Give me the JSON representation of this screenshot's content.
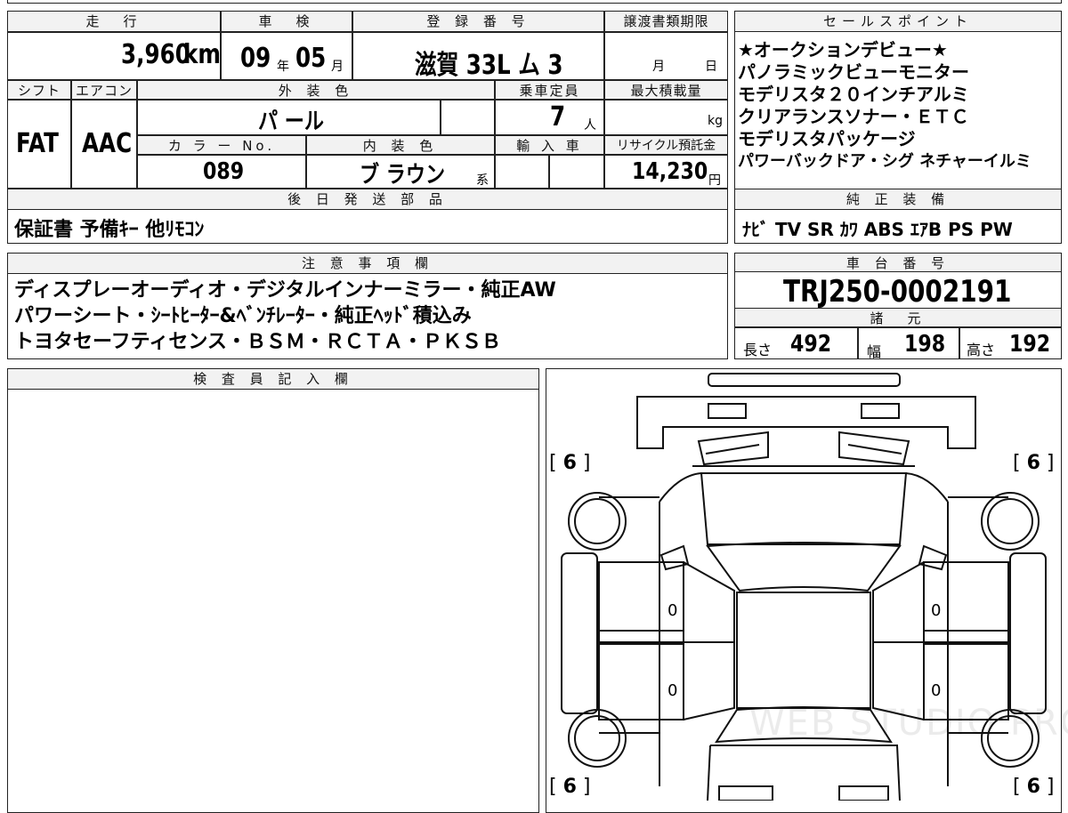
{
  "top": {
    "mileage_label": "走　行",
    "mileage": "3,960",
    "mileage_unit": "km",
    "inspection_label": "車　検",
    "inspection_year": "09",
    "inspection_year_unit": "年",
    "inspection_month": "05",
    "inspection_month_unit": "月",
    "registration_label": "登 録 番 号",
    "registration": "滋賀 33L ム 3",
    "transfer_label": "譲渡書類期限",
    "transfer_month_unit": "月",
    "transfer_day_unit": "日"
  },
  "spec": {
    "shift_label": "シフト",
    "shift": "FAT",
    "ac_label": "エアコン",
    "ac": "AAC",
    "exterior_label": "外 装 色",
    "exterior": "パ ール",
    "capacity_label": "乗車定員",
    "capacity": "7",
    "capacity_unit": "人",
    "max_load_label": "最大積載量",
    "max_load_unit": "kg",
    "color_no_label": "カ ラ ー No.",
    "color_no": "089",
    "interior_label": "内 装 色",
    "interior": "ブ ラウン",
    "interior_suffix": "系",
    "import_label": "輸 入 車",
    "recycle_label": "リサイクル預託金",
    "recycle": "14,230",
    "recycle_unit": "円"
  },
  "parts": {
    "label": "後 日 発 送 部 品",
    "value": "保証書 予備ｷｰ 他ﾘﾓｺﾝ"
  },
  "sales": {
    "label": "セールスポイント",
    "lines": [
      "★オークションデビュー★",
      "パノラミックビューモニター",
      "モデリスタ２０インチアルミ",
      "クリアランスソナー・ＥＴＣ",
      "モデリスタパッケージ",
      "パワーバックドア・シグ ネチャーイルミ"
    ]
  },
  "equipment": {
    "label": "純 正 装 備",
    "value": "ﾅﾋﾞ TV SR ｶﾜ ABS ｴｱB PS PW"
  },
  "notes": {
    "label": "注 意 事 項 欄",
    "lines": [
      "ディスプレーオーディオ・デジタルインナーミラー・純正AW",
      "パワーシート・ｼｰﾄﾋｰﾀｰ&ﾍﾞﾝﾁﾚｰﾀｰ・純正ﾍｯﾄﾞ積込み",
      "トヨタセーフティセンス・ＢＳＭ・ＲＣＴＡ・ＰＫＳＢ"
    ]
  },
  "chassis": {
    "label": "車 台 番 号",
    "value": "TRJ250-0002191",
    "specs_label": "諸　元",
    "length_label": "長さ",
    "length": "492",
    "width_label": "幅",
    "width": "198",
    "height_label": "高さ",
    "height": "192"
  },
  "inspector": {
    "label": "検 査 員 記 入 欄"
  },
  "diagram": {
    "tire_fl": "6",
    "tire_fr": "6",
    "tire_rl": "6",
    "tire_rr": "6",
    "door_fl": "0",
    "door_fr": "0",
    "door_rl": "0",
    "door_rr": "0",
    "watermark": "WEB STUDIO PRO"
  }
}
